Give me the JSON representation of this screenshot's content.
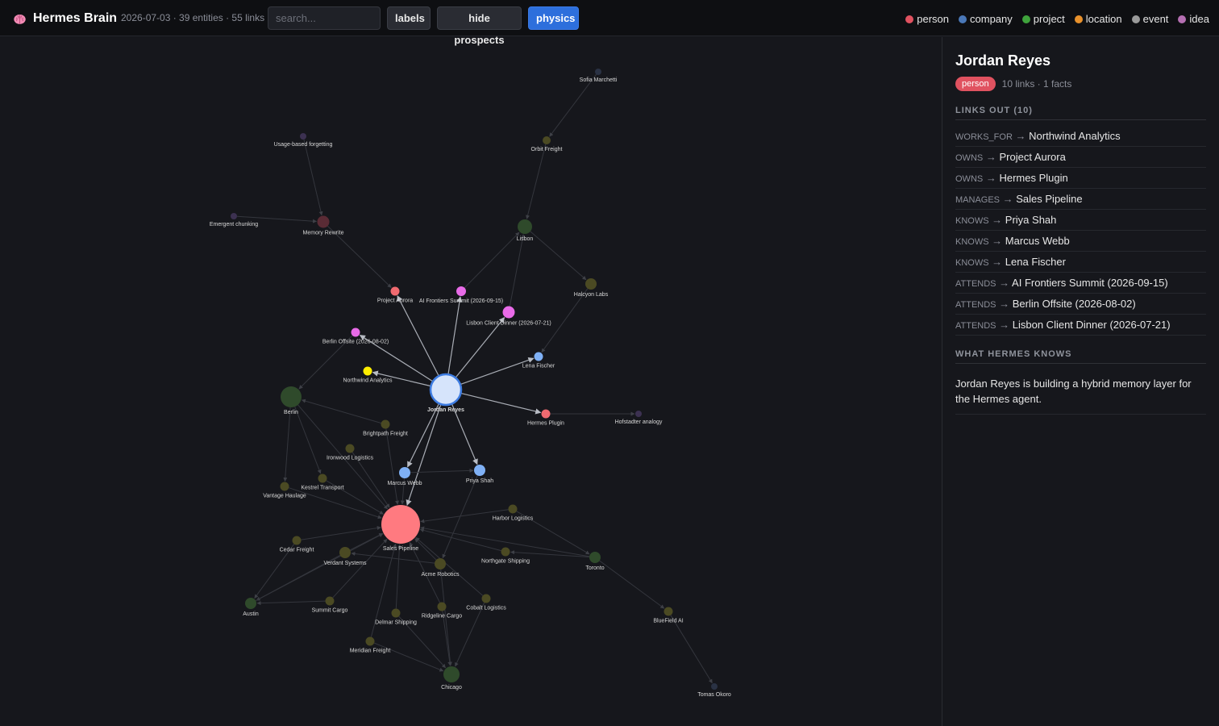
{
  "app": {
    "title": "Hermes Brain",
    "meta": "2026-07-03 · 39 entities · 55 links",
    "icon": "brain-icon"
  },
  "toolbar": {
    "search_placeholder": "search...",
    "labels_label": "labels",
    "hide_prospects_label": "hide prospects",
    "physics_label": "physics",
    "physics_active": true
  },
  "legend": [
    {
      "label": "person",
      "color": "#e05260"
    },
    {
      "label": "company",
      "color": "#4a78b8"
    },
    {
      "label": "project",
      "color": "#3fa33c"
    },
    {
      "label": "location",
      "color": "#e8912c"
    },
    {
      "label": "event",
      "color": "#9a9a9a"
    },
    {
      "label": "idea",
      "color": "#b56fb2"
    }
  ],
  "colors": {
    "selected": "#d6e4fb",
    "selected_stroke": "#3d7be0",
    "person_blue": "#7fb0f5",
    "red": "#f06a70",
    "magenta": "#e86be8",
    "yellow": "#ffee00",
    "olive": "#4b4a23",
    "green_dim": "#2f4a2b",
    "purple_dim": "#3c3151",
    "blue_dim": "#2a3244",
    "maroon_dim": "#5a2b35"
  },
  "graph": {
    "nodes": [
      {
        "id": "jordan",
        "label": "Jordan Reyes",
        "color": "#d6e4fb",
        "stroke": "#3d7be0",
        "bold": true
      },
      {
        "id": "sales",
        "label": "Sales Pipeline",
        "color": "#ff7a80"
      },
      {
        "id": "aurora",
        "label": "Project Aurora",
        "color": "#f06a70"
      },
      {
        "id": "aisummit",
        "label": "AI Frontiers Summit (2026-09-15)",
        "color": "#e86be8"
      },
      {
        "id": "lisbondinner",
        "label": "Lisbon Client Dinner (2026-07-21)",
        "color": "#e86be8"
      },
      {
        "id": "berlinoffsite",
        "label": "Berlin Offsite (2026-08-02)",
        "color": "#e86be8"
      },
      {
        "id": "northwind",
        "label": "Northwind Analytics",
        "color": "#ffee00"
      },
      {
        "id": "lena",
        "label": "Lena Fischer",
        "color": "#7fb0f5"
      },
      {
        "id": "plugin",
        "label": "Hermes Plugin",
        "color": "#f06a70"
      },
      {
        "id": "marcus",
        "label": "Marcus Webb",
        "color": "#7fb0f5"
      },
      {
        "id": "priya",
        "label": "Priya Shah",
        "color": "#7fb0f5"
      },
      {
        "id": "sofia",
        "label": "Sofia Marchetti",
        "color": "#2a3244"
      },
      {
        "id": "orbit",
        "label": "Orbit Freight",
        "color": "#4b4a23"
      },
      {
        "id": "lisbon",
        "label": "Lisbon",
        "color": "#2f4a2b"
      },
      {
        "id": "halcyon",
        "label": "Halcyon Labs",
        "color": "#4b4a23"
      },
      {
        "id": "usage",
        "label": "Usage-based forgetting",
        "color": "#3c3151"
      },
      {
        "id": "memory",
        "label": "Memory Rewrite",
        "color": "#5a2b35"
      },
      {
        "id": "emergent",
        "label": "Emergent chunking",
        "color": "#3c3151"
      },
      {
        "id": "berlin",
        "label": "Berlin",
        "color": "#2f4a2b"
      },
      {
        "id": "hofstadter",
        "label": "Hofstadter analogy",
        "color": "#3c3151"
      },
      {
        "id": "brightpath",
        "label": "Brightpath Freight",
        "color": "#4b4a23"
      },
      {
        "id": "ironwood",
        "label": "Ironwood Logistics",
        "color": "#4b4a23"
      },
      {
        "id": "kestrel",
        "label": "Kestrel Transport",
        "color": "#4b4a23"
      },
      {
        "id": "vantage",
        "label": "Vantage Haulage",
        "color": "#4b4a23"
      },
      {
        "id": "harbor",
        "label": "Harbor Logistics",
        "color": "#4b4a23"
      },
      {
        "id": "cedar",
        "label": "Cedar Freight",
        "color": "#4b4a23"
      },
      {
        "id": "verdant",
        "label": "Verdant Systems",
        "color": "#4b4a23"
      },
      {
        "id": "northgate",
        "label": "Northgate Shipping",
        "color": "#4b4a23"
      },
      {
        "id": "toronto",
        "label": "Toronto",
        "color": "#2f4a2b"
      },
      {
        "id": "acme",
        "label": "Acme Robotics",
        "color": "#4b4a23"
      },
      {
        "id": "austin",
        "label": "Austin",
        "color": "#2f4a2b"
      },
      {
        "id": "summit",
        "label": "Summit Cargo",
        "color": "#4b4a23"
      },
      {
        "id": "ridgeline",
        "label": "Ridgeline Cargo",
        "color": "#4b4a23"
      },
      {
        "id": "cobalt",
        "label": "Cobalt Logistics",
        "color": "#4b4a23"
      },
      {
        "id": "delmar",
        "label": "Delmar Shipping",
        "color": "#4b4a23"
      },
      {
        "id": "bluefield",
        "label": "BlueField AI",
        "color": "#4b4a23"
      },
      {
        "id": "meridian",
        "label": "Meridian Freight",
        "color": "#4b4a23"
      },
      {
        "id": "chicago",
        "label": "Chicago",
        "color": "#2f4a2b"
      },
      {
        "id": "tomas",
        "label": "Tomas Okoro",
        "color": "#2a3244"
      }
    ],
    "edges": [
      {
        "from": "jordan",
        "to": "northwind",
        "hl": true
      },
      {
        "from": "jordan",
        "to": "aurora",
        "hl": true
      },
      {
        "from": "jordan",
        "to": "plugin",
        "hl": true
      },
      {
        "from": "jordan",
        "to": "sales",
        "hl": true
      },
      {
        "from": "jordan",
        "to": "priya",
        "hl": true
      },
      {
        "from": "jordan",
        "to": "marcus",
        "hl": true
      },
      {
        "from": "jordan",
        "to": "lena",
        "hl": true
      },
      {
        "from": "jordan",
        "to": "aisummit",
        "hl": true
      },
      {
        "from": "jordan",
        "to": "berlinoffsite",
        "hl": true
      },
      {
        "from": "jordan",
        "to": "lisbondinner",
        "hl": true
      },
      {
        "from": "sofia",
        "to": "orbit"
      },
      {
        "from": "orbit",
        "to": "lisbon"
      },
      {
        "from": "aisummit",
        "to": "lisbon"
      },
      {
        "from": "lisbondinner",
        "to": "lisbon"
      },
      {
        "from": "lisbon",
        "to": "halcyon"
      },
      {
        "from": "halcyon",
        "to": "lena"
      },
      {
        "from": "usage",
        "to": "memory"
      },
      {
        "from": "emergent",
        "to": "memory"
      },
      {
        "from": "memory",
        "to": "aurora"
      },
      {
        "from": "berlinoffsite",
        "to": "berlin"
      },
      {
        "from": "plugin",
        "to": "hofstadter"
      },
      {
        "from": "brightpath",
        "to": "berlin"
      },
      {
        "from": "berlin",
        "to": "vantage"
      },
      {
        "from": "berlin",
        "to": "kestrel"
      },
      {
        "from": "berlin",
        "to": "sales"
      },
      {
        "from": "brightpath",
        "to": "sales"
      },
      {
        "from": "ironwood",
        "to": "sales"
      },
      {
        "from": "kestrel",
        "to": "sales"
      },
      {
        "from": "vantage",
        "to": "sales"
      },
      {
        "from": "marcus",
        "to": "priya"
      },
      {
        "from": "marcus",
        "to": "sales"
      },
      {
        "from": "priya",
        "to": "acme"
      },
      {
        "from": "harbor",
        "to": "sales"
      },
      {
        "from": "harbor",
        "to": "toronto"
      },
      {
        "from": "cedar",
        "to": "sales"
      },
      {
        "from": "verdant",
        "to": "sales"
      },
      {
        "from": "northgate",
        "to": "sales"
      },
      {
        "from": "toronto",
        "to": "northgate"
      },
      {
        "from": "toronto",
        "to": "sales"
      },
      {
        "from": "toronto",
        "to": "bluefield"
      },
      {
        "from": "bluefield",
        "to": "tomas"
      },
      {
        "from": "acme",
        "to": "sales"
      },
      {
        "from": "acme",
        "to": "verdant"
      },
      {
        "from": "acme",
        "to": "chicago"
      },
      {
        "from": "cedar",
        "to": "austin"
      },
      {
        "from": "verdant",
        "to": "austin"
      },
      {
        "from": "summit",
        "to": "austin"
      },
      {
        "from": "summit",
        "to": "sales"
      },
      {
        "from": "austin",
        "to": "sales"
      },
      {
        "from": "ridgeline",
        "to": "sales"
      },
      {
        "from": "ridgeline",
        "to": "chicago"
      },
      {
        "from": "cobalt",
        "to": "sales"
      },
      {
        "from": "cobalt",
        "to": "chicago"
      },
      {
        "from": "delmar",
        "to": "sales"
      },
      {
        "from": "delmar",
        "to": "chicago"
      },
      {
        "from": "meridian",
        "to": "chicago"
      },
      {
        "from": "meridian",
        "to": "sales"
      }
    ]
  },
  "panel": {
    "name": "Jordan Reyes",
    "type": "person",
    "counts": "10 links · 1 facts",
    "links_title": "LINKS OUT (10)",
    "links": [
      {
        "rel": "WORKS_FOR",
        "target": "Northwind Analytics"
      },
      {
        "rel": "OWNS",
        "target": "Project Aurora"
      },
      {
        "rel": "OWNS",
        "target": "Hermes Plugin"
      },
      {
        "rel": "MANAGES",
        "target": "Sales Pipeline"
      },
      {
        "rel": "KNOWS",
        "target": "Priya Shah"
      },
      {
        "rel": "KNOWS",
        "target": "Marcus Webb"
      },
      {
        "rel": "KNOWS",
        "target": "Lena Fischer"
      },
      {
        "rel": "ATTENDS",
        "target": "AI Frontiers Summit (2026-09-15)"
      },
      {
        "rel": "ATTENDS",
        "target": "Berlin Offsite (2026-08-02)"
      },
      {
        "rel": "ATTENDS",
        "target": "Lisbon Client Dinner (2026-07-21)"
      }
    ],
    "knows_title": "WHAT HERMES KNOWS",
    "knows_text": "Jordan Reyes is building a hybrid memory layer for the Hermes agent."
  }
}
